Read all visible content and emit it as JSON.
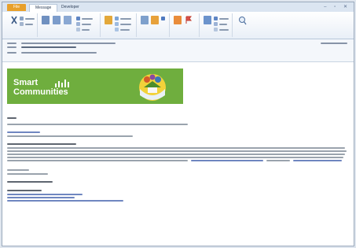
{
  "ribbon": {
    "tabs": [
      "File",
      "Message",
      "Developer"
    ]
  },
  "banner": {
    "line1": "Smart",
    "line2": "Communities"
  },
  "colors": {
    "tab_file": "#e8a02b",
    "banner_green": "#6fae3e",
    "link_blue": "#6f86c0"
  }
}
